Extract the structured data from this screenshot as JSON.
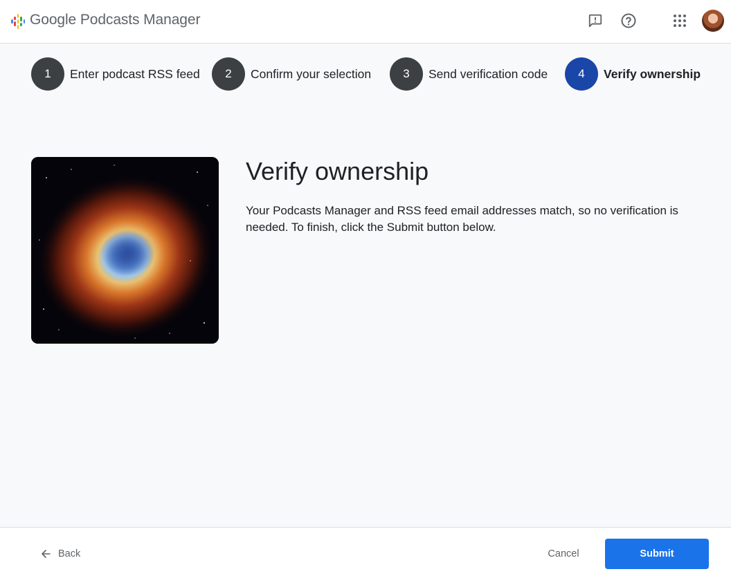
{
  "header": {
    "app_title": "Google Podcasts Manager",
    "icons": [
      "feedback-icon",
      "help-icon",
      "apps-icon"
    ]
  },
  "stepper": {
    "steps": [
      {
        "number": "1",
        "label": "Enter podcast RSS feed"
      },
      {
        "number": "2",
        "label": "Confirm your selection"
      },
      {
        "number": "3",
        "label": "Send verification code"
      },
      {
        "number": "4",
        "label": "Verify ownership"
      }
    ],
    "active_step": 4,
    "colors": {
      "inactive": "#3c4043",
      "active": "#1a46a8"
    }
  },
  "main": {
    "title": "Verify ownership",
    "description": "Your Podcasts Manager and RSS feed email addresses match, so no verification is needed. To finish, click the Submit button below."
  },
  "footer": {
    "back_label": "Back",
    "cancel_label": "Cancel",
    "submit_label": "Submit",
    "submit_color": "#1a73e8"
  }
}
